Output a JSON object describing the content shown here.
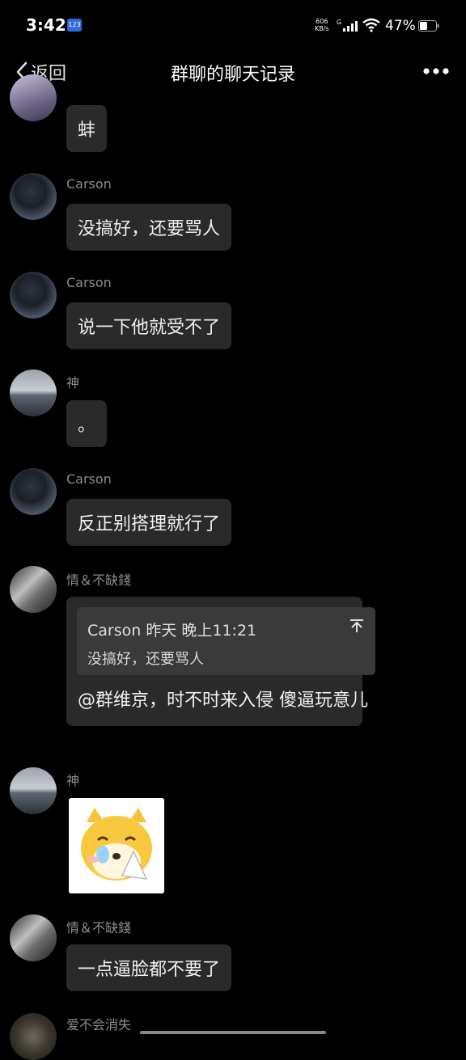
{
  "status_bar": {
    "time": "3:42",
    "notification_badge": "123",
    "net_speed_value": "606",
    "net_speed_unit": "KB/s",
    "network_type": "G",
    "battery_percent": "47%",
    "battery_level": 0.47
  },
  "nav": {
    "back_label": "返回",
    "title": "群聊的聊天记录",
    "more_icon": "more-dots-icon"
  },
  "messages": [
    {
      "sender": "",
      "text": "蚌"
    },
    {
      "sender": "Carson",
      "text": "没搞好，还要骂人"
    },
    {
      "sender": "Carson",
      "text": "说一下他就受不了"
    },
    {
      "sender": "神",
      "text": "。"
    },
    {
      "sender": "Carson",
      "text": "反正别搭理就行了"
    },
    {
      "sender": "情＆不缺錢",
      "quote_header": "Carson 昨天 晚上11:21",
      "quote_text": "没搞好，还要骂人",
      "text": "@群维京，时不时来入侵 傻逼玩意儿"
    },
    {
      "sender": "神",
      "sticker": "crying-dog-sticker"
    },
    {
      "sender": "情＆不缺錢",
      "text": "一点逼脸都不要了"
    },
    {
      "sender": "爱不会消失"
    }
  ],
  "colors": {
    "background": "#000000",
    "bubble": "#2a2a2a",
    "quote_box": "#3a3a3a",
    "sender_name": "#8c8c8c"
  }
}
